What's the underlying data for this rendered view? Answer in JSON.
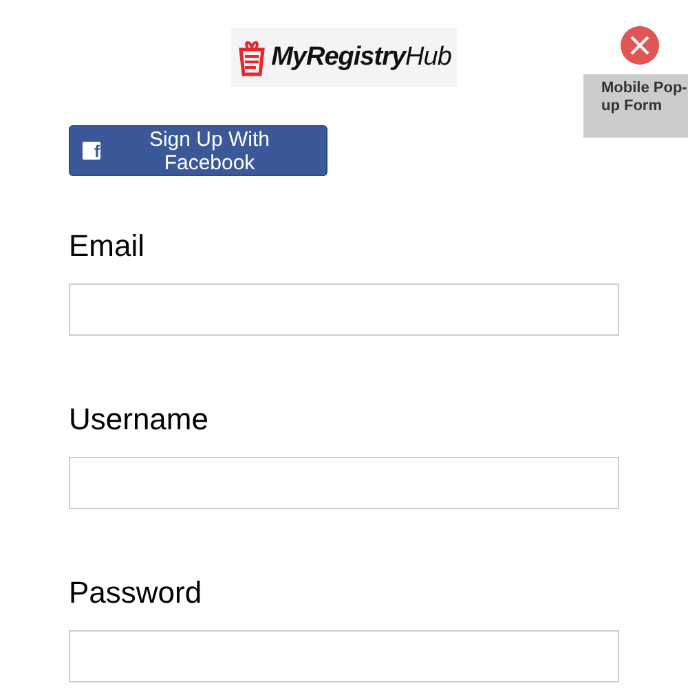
{
  "logo": {
    "text": "**MyRegistry**Hub"
  },
  "badge": "Mobile Pop-up Form",
  "facebook_button": {
    "icon": "f",
    "label": "Sign Up With Facebook"
  },
  "fields": [
    {
      "label": "Email"
    },
    {
      "label": "Username"
    },
    {
      "label": "Password"
    }
  ]
}
